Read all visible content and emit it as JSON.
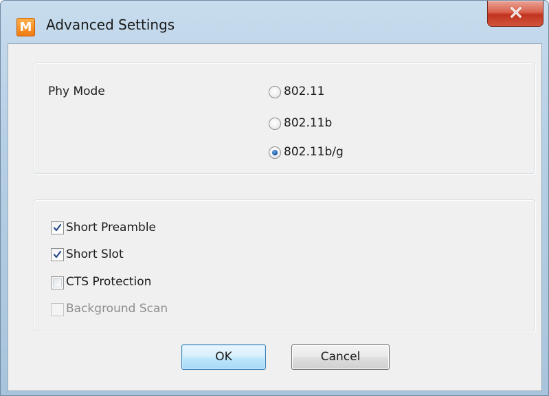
{
  "window": {
    "icon_letter": "M",
    "title": "Advanced Settings"
  },
  "phy_mode": {
    "label": "Phy Mode",
    "options": [
      {
        "label": "802.11",
        "selected": false
      },
      {
        "label": "802.11b",
        "selected": false
      },
      {
        "label": "802.11b/g",
        "selected": true
      }
    ]
  },
  "options": {
    "items": [
      {
        "label": "Short Preamble",
        "checked": true,
        "enabled": true
      },
      {
        "label": "Short Slot",
        "checked": true,
        "enabled": true
      },
      {
        "label": "CTS Protection",
        "checked": false,
        "enabled": true
      },
      {
        "label": "Background Scan",
        "checked": false,
        "enabled": false
      }
    ]
  },
  "buttons": {
    "ok": "OK",
    "cancel": "Cancel"
  },
  "colors": {
    "title_bar": "#b5cee4",
    "close_button": "#c0331f",
    "dialog_background": "#f0f0f0",
    "radio_selected": "#1f5fa8",
    "check_mark": "#2a4b8d",
    "ok_button_border": "#3c7fb1"
  },
  "icons": {
    "app": "app-logo-icon",
    "close": "close-icon",
    "check": "checkmark-icon"
  }
}
